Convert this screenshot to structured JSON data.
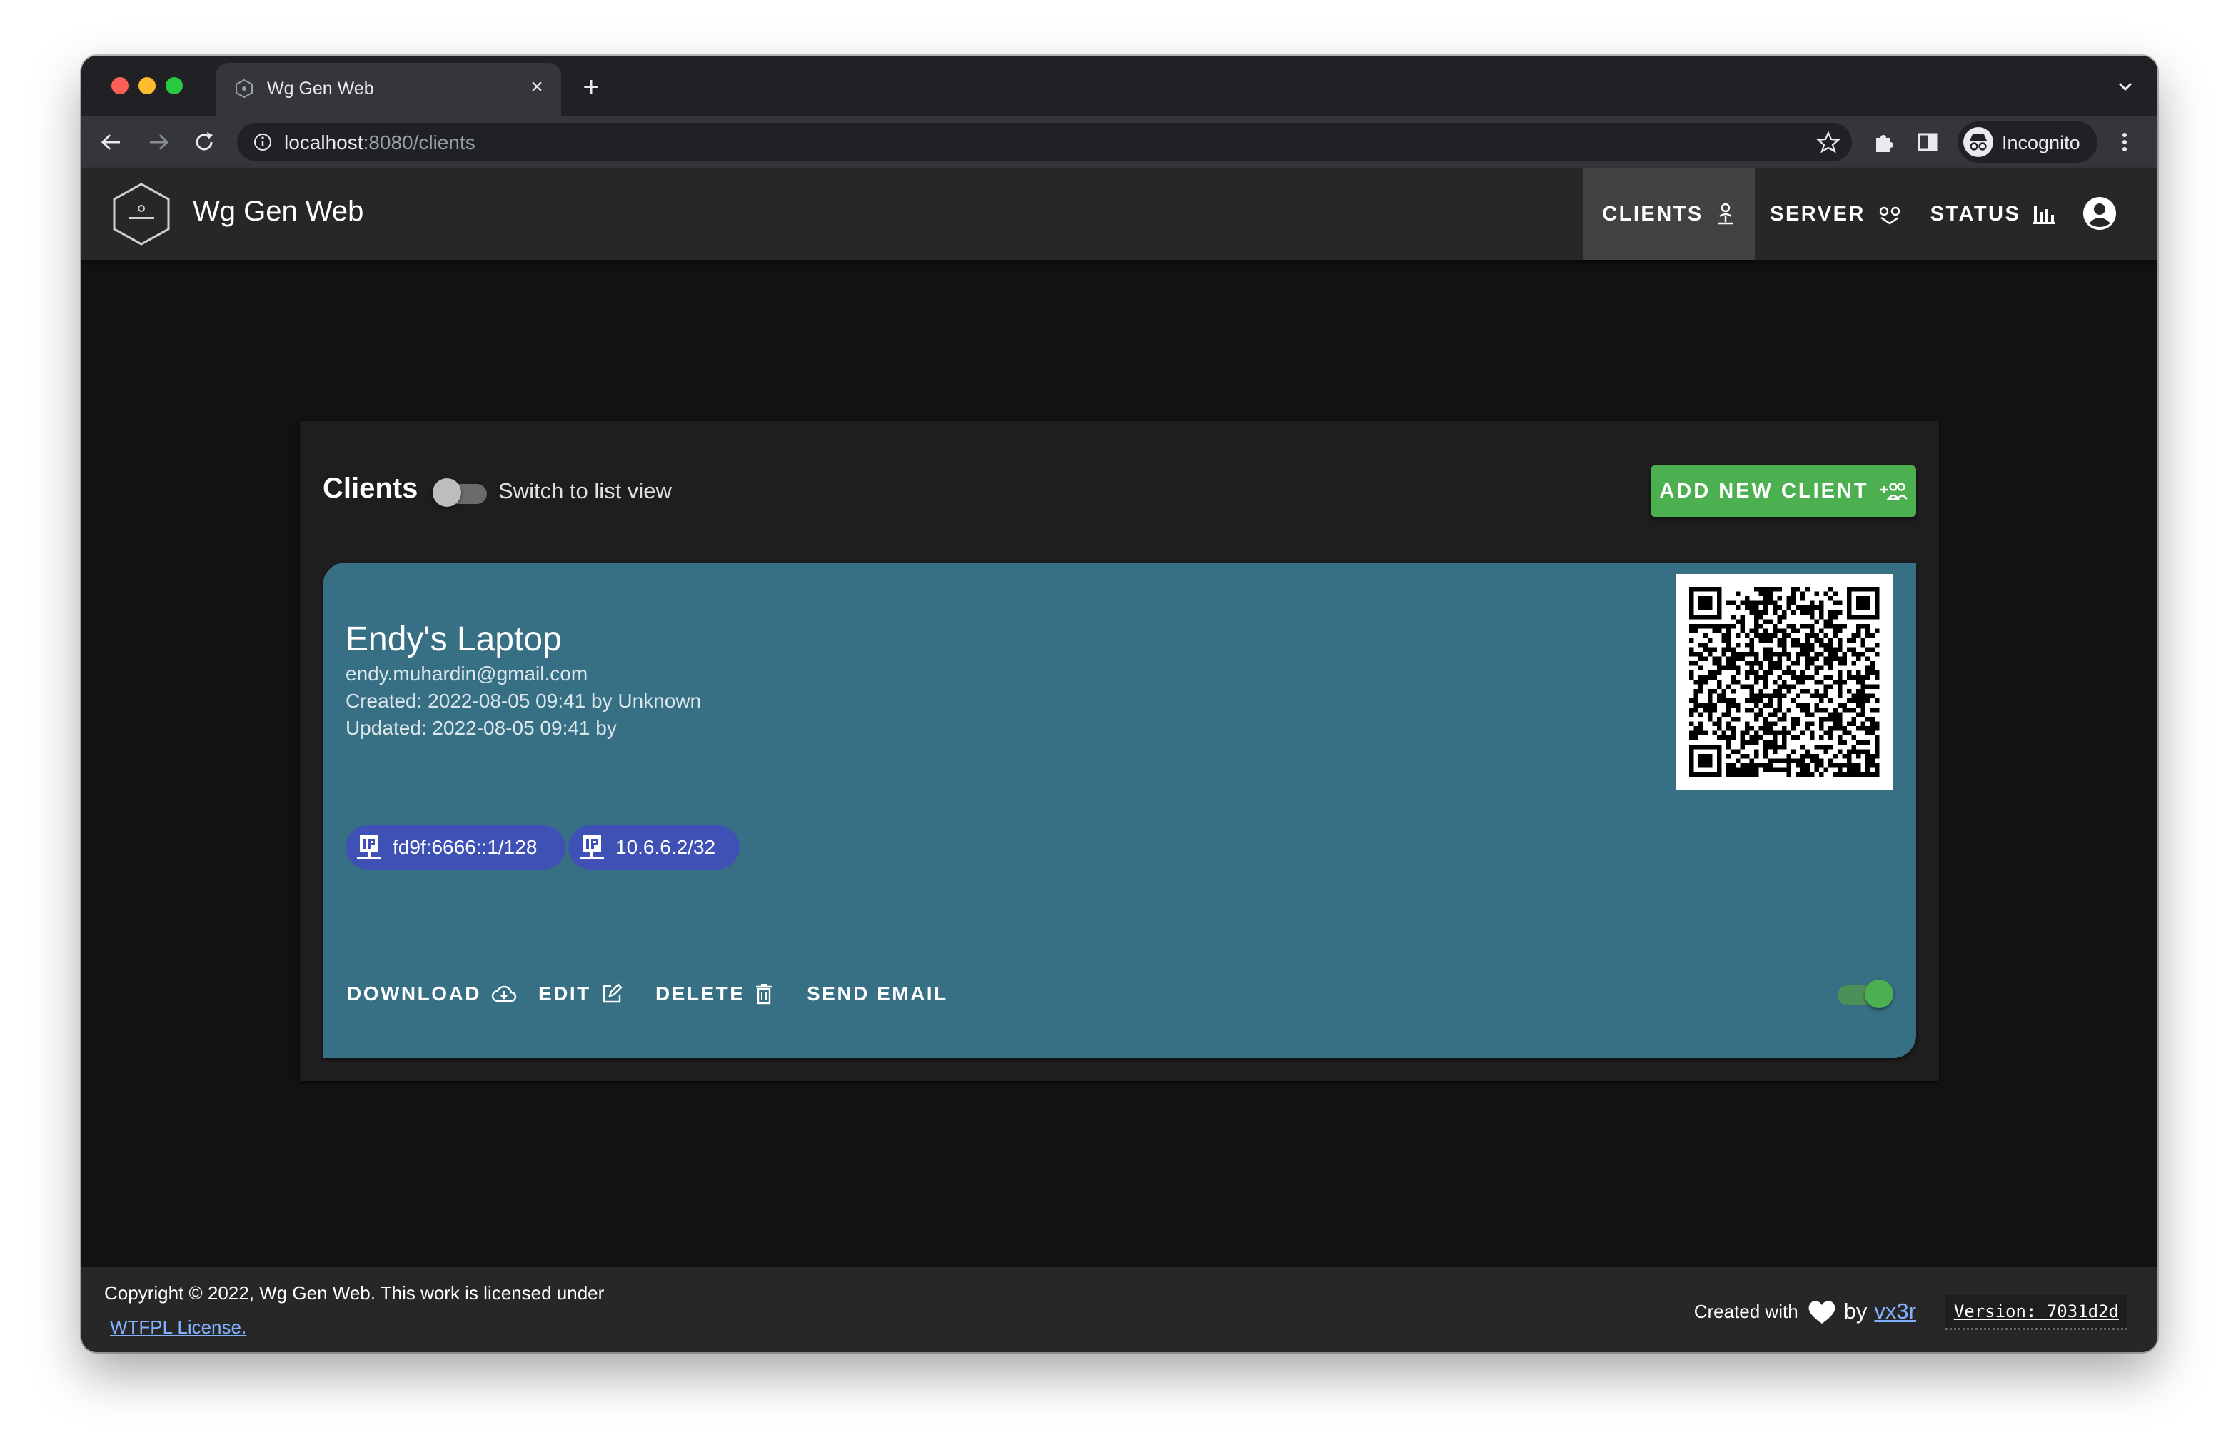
{
  "browser": {
    "tab_title": "Wg Gen Web",
    "url_host": "localhost",
    "url_path": ":8080/clients",
    "profile_label": "Incognito"
  },
  "app": {
    "title": "Wg Gen Web",
    "nav": [
      {
        "label": "CLIENTS",
        "icon": "account-network-icon",
        "active": true
      },
      {
        "label": "SERVER",
        "icon": "vpn-icon",
        "active": false
      },
      {
        "label": "STATUS",
        "icon": "bar-chart-icon",
        "active": false
      }
    ]
  },
  "main": {
    "heading": "Clients",
    "view_switch_label": "Switch to list view",
    "add_button_label": "ADD NEW CLIENT",
    "clients": [
      {
        "name": "Endy's Laptop",
        "email": "endy.muhardin@gmail.com",
        "created": "Created: 2022-08-05 09:41 by Unknown",
        "updated": "Updated: 2022-08-05 09:41 by",
        "addresses": [
          "fd9f:6666::1/128",
          "10.6.6.2/32"
        ],
        "actions": {
          "download": "DOWNLOAD",
          "edit": "EDIT",
          "delete": "DELETE",
          "send_email": "SEND EMAIL"
        },
        "enabled": true
      }
    ]
  },
  "footer": {
    "copyright": "Copyright © 2022, Wg Gen Web. This work is licensed under",
    "license_link": "WTFPL License.",
    "created_with": "Created with",
    "by": "by",
    "author": "vx3r",
    "version": "Version: 7031d2d"
  },
  "colors": {
    "accent_green": "#4caf50",
    "chip_indigo": "#3f51b5",
    "card_teal": "#376f84",
    "link_blue": "#82b1ff"
  }
}
